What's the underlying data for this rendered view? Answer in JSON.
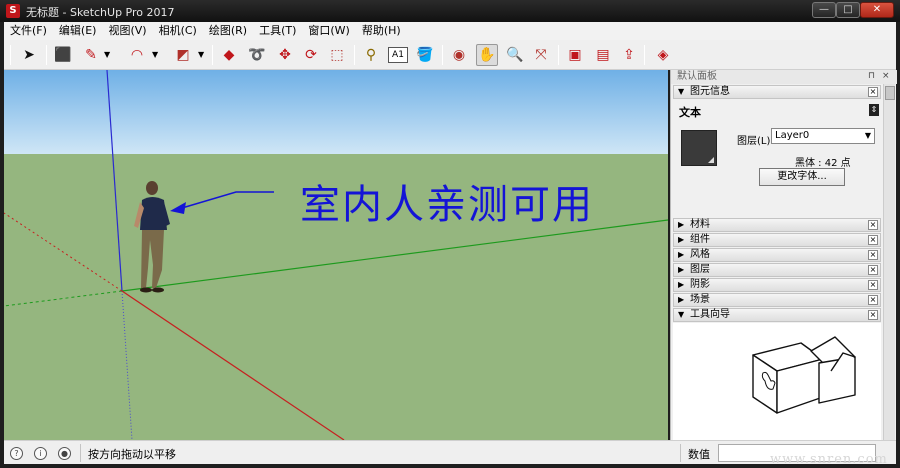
{
  "window": {
    "app_icon": "S",
    "title": "无标题 - SketchUp Pro 2017",
    "min_glyph": "—",
    "max_glyph": "□",
    "close_glyph": "✕"
  },
  "menus": [
    "文件(F)",
    "编辑(E)",
    "视图(V)",
    "相机(C)",
    "绘图(R)",
    "工具(T)",
    "窗口(W)",
    "帮助(H)"
  ],
  "toolbar": {
    "icons": [
      {
        "name": "select-arrow-icon",
        "glyph": "➤"
      },
      {
        "name": "eraser-icon",
        "glyph": "⬛"
      },
      {
        "name": "pencil-line-icon",
        "glyph": "✎"
      },
      {
        "name": "arc-icon",
        "glyph": "◠"
      },
      {
        "name": "rectangle-icon",
        "glyph": "◩"
      },
      {
        "name": "push-pull-icon",
        "glyph": "◆"
      },
      {
        "name": "follow-me-icon",
        "glyph": "➰"
      },
      {
        "name": "move-icon",
        "glyph": "✥"
      },
      {
        "name": "rotate-icon",
        "glyph": "⟳"
      },
      {
        "name": "scale-icon",
        "glyph": "⬚"
      },
      {
        "name": "tape-measure-icon",
        "glyph": "⚲"
      },
      {
        "name": "text-icon",
        "glyph": "A1"
      },
      {
        "name": "paint-bucket-icon",
        "glyph": "🪣"
      },
      {
        "name": "orbit-icon",
        "glyph": "◉"
      },
      {
        "name": "pan-hand-icon",
        "glyph": "✋"
      },
      {
        "name": "zoom-icon",
        "glyph": "🔍"
      },
      {
        "name": "zoom-extents-icon",
        "glyph": "⤧"
      },
      {
        "name": "warehouse-icon",
        "glyph": "▣"
      },
      {
        "name": "extension-warehouse-icon",
        "glyph": "▤"
      },
      {
        "name": "share-model-icon",
        "glyph": "⇪"
      },
      {
        "name": "ruby-extension-icon",
        "glyph": "◈"
      }
    ]
  },
  "viewport": {
    "caption": "室内人亲测可用",
    "colors": {
      "sky_top": "#6fb0e6",
      "sky_bottom": "#cfe6f6",
      "ground": "#95b67f",
      "caption": "#1414d6"
    }
  },
  "tray": {
    "title": "默认面板",
    "pin_glyph": "⊓",
    "close_glyph": "×",
    "entity_info": {
      "header": "图元信息",
      "type": "文本",
      "layer_label": "图层(L):",
      "layer_value": "Layer0",
      "font_info": "黑体 : 42 点",
      "change_font_button": "更改字体..."
    },
    "sections": [
      "材料",
      "组件",
      "风格",
      "图层",
      "阴影",
      "场景"
    ],
    "instructor": {
      "header": "工具向导"
    }
  },
  "statusbar": {
    "icon1": "?",
    "icon2": "i",
    "icon3": "●",
    "hint": "按方向拖动以平移",
    "measure_label": "数值",
    "measure_value": ""
  },
  "watermark": "www.snren.com"
}
